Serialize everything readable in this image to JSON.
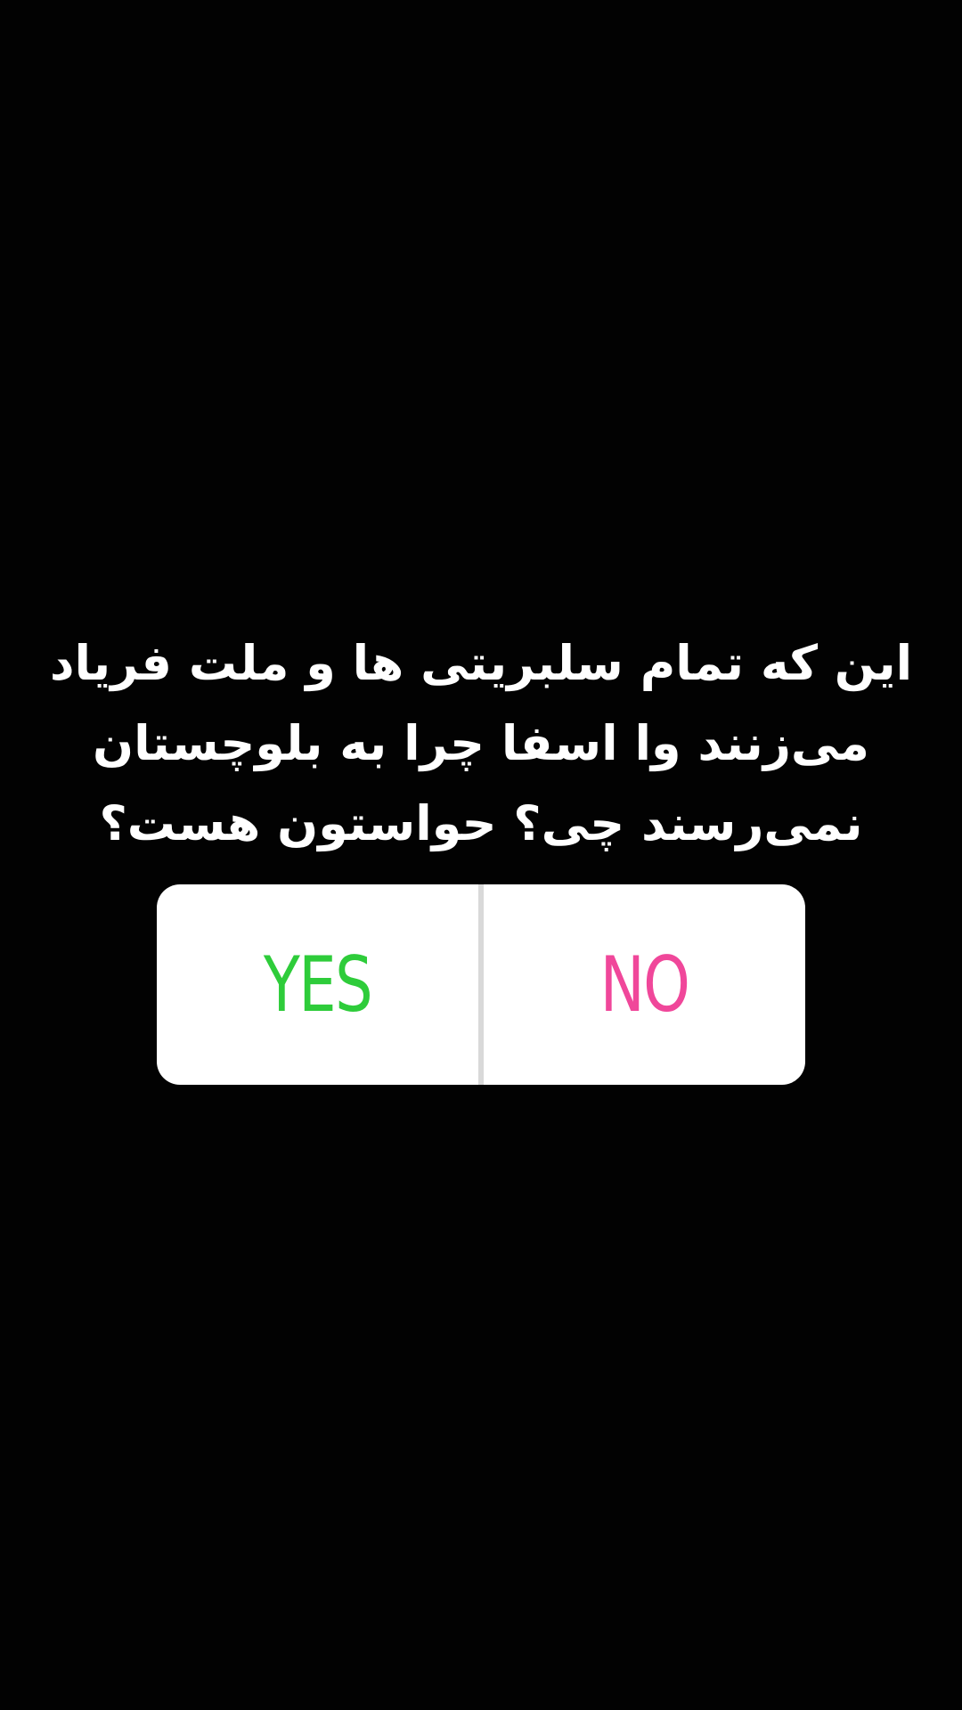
{
  "question": {
    "lines": [
      "این که تمام سلبریتی ها و ملت فریاد",
      "می‌زنند وا اسفا چرا به بلوچستان",
      "نمی‌رسند چی؟ حواستون هست؟"
    ]
  },
  "poll": {
    "yes_label": "YES",
    "no_label": "NO",
    "colors": {
      "yes": "#2ecc3a",
      "no": "#f0479a",
      "card": "#ffffff",
      "divider": "#d9d9d9",
      "background": "#000000"
    }
  }
}
